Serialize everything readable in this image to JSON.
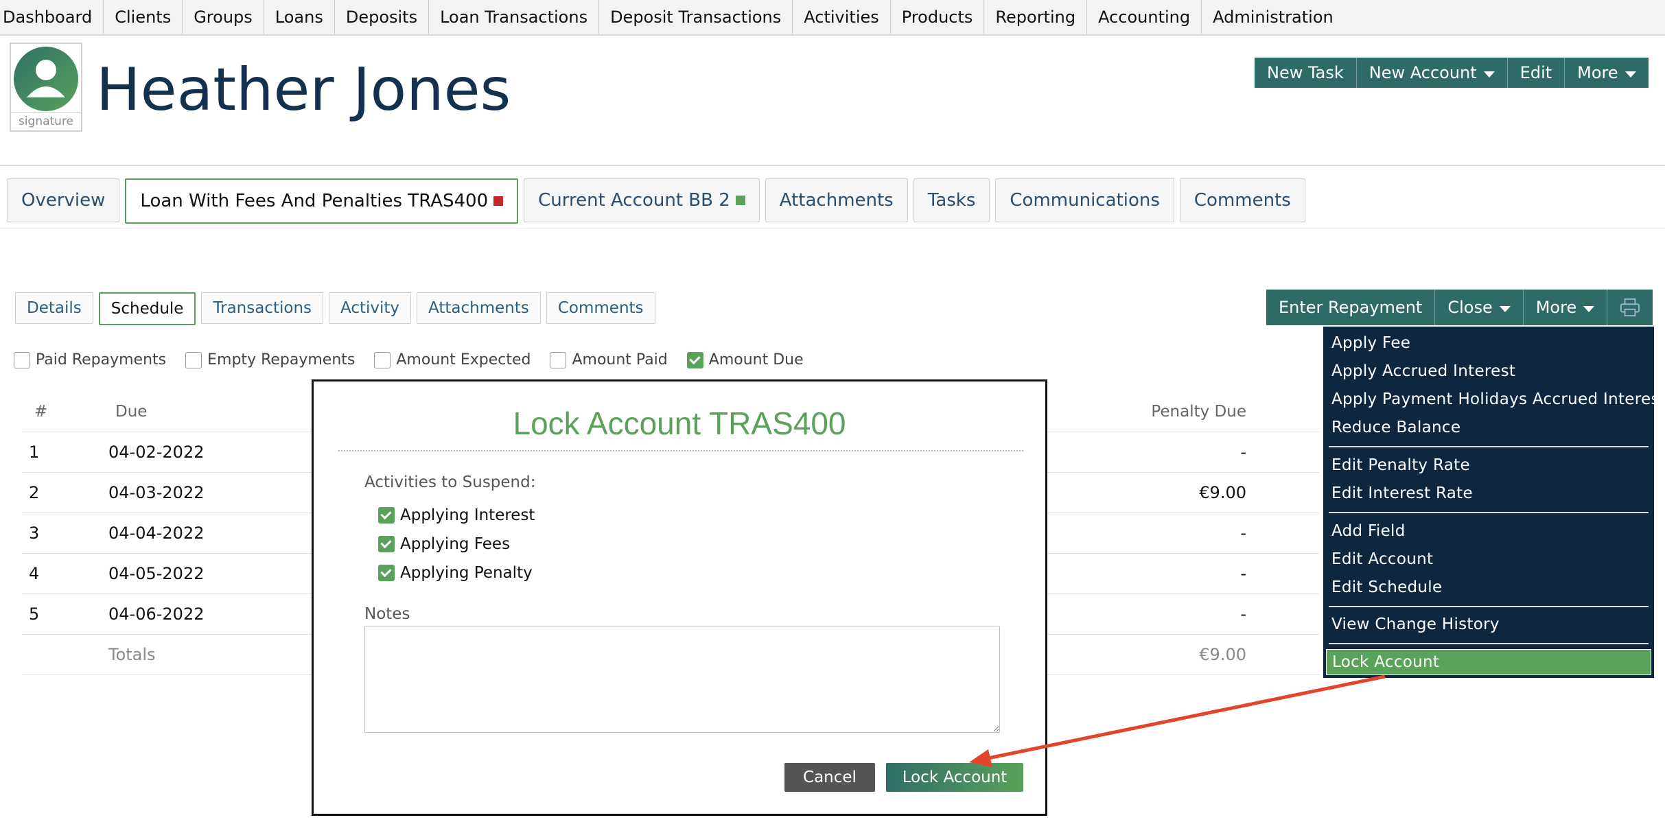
{
  "nav": [
    "Dashboard",
    "Clients",
    "Groups",
    "Loans",
    "Deposits",
    "Loan Transactions",
    "Deposit Transactions",
    "Activities",
    "Products",
    "Reporting",
    "Accounting",
    "Administration"
  ],
  "avatar": {
    "signature_label": "signature"
  },
  "client": {
    "name": "Heather Jones"
  },
  "header_actions": {
    "new_task": "New Task",
    "new_account": "New Account",
    "edit": "Edit",
    "more": "More"
  },
  "tabs": [
    {
      "label": "Overview"
    },
    {
      "label": "Loan With Fees And Penalties TRAS400",
      "marker_color": "#c62828"
    },
    {
      "label": "Current Account BB 2",
      "marker_color": "#5aa159"
    },
    {
      "label": "Attachments"
    },
    {
      "label": "Tasks"
    },
    {
      "label": "Communications"
    },
    {
      "label": "Comments"
    }
  ],
  "sub_tabs": [
    "Details",
    "Schedule",
    "Transactions",
    "Activity",
    "Attachments",
    "Comments"
  ],
  "loan_actions": {
    "enter_repayment": "Enter Repayment",
    "close": "Close",
    "more": "More",
    "print_icon": "printer-icon"
  },
  "filters": [
    {
      "label": "Paid Repayments",
      "checked": false
    },
    {
      "label": "Empty Repayments",
      "checked": false
    },
    {
      "label": "Amount Expected",
      "checked": false
    },
    {
      "label": "Amount Paid",
      "checked": false
    },
    {
      "label": "Amount Due",
      "checked": true
    }
  ],
  "schedule": {
    "headers": {
      "num": "#",
      "due": "Due",
      "penalty_due": "Penalty Due"
    },
    "rows": [
      {
        "num": "1",
        "due": "04-02-2022",
        "penalty": "-"
      },
      {
        "num": "2",
        "due": "04-03-2022",
        "penalty": "€9.00"
      },
      {
        "num": "3",
        "due": "04-04-2022",
        "penalty": "-"
      },
      {
        "num": "4",
        "due": "04-05-2022",
        "penalty": "-"
      },
      {
        "num": "5",
        "due": "04-06-2022",
        "penalty": "-"
      }
    ],
    "totals": {
      "label": "Totals",
      "penalty": "€9.00"
    }
  },
  "more_menu": [
    [
      "Apply Fee",
      "Apply Accrued Interest",
      "Apply Payment Holidays Accrued Interest",
      "Reduce Balance"
    ],
    [
      "Edit Penalty Rate",
      "Edit Interest Rate"
    ],
    [
      "Add Field",
      "Edit Account",
      "Edit Schedule"
    ],
    [
      "View Change History"
    ],
    [
      "Lock Account"
    ]
  ],
  "modal": {
    "title": "Lock Account TRAS400",
    "suspend_label": "Activities to Suspend:",
    "options": [
      {
        "label": "Applying Interest",
        "checked": true
      },
      {
        "label": "Applying Fees",
        "checked": true
      },
      {
        "label": "Applying Penalty",
        "checked": true
      }
    ],
    "notes_label": "Notes",
    "notes_value": "",
    "cancel": "Cancel",
    "submit": "Lock Account"
  },
  "colors": {
    "accent": "#5aa159",
    "teal": "#2e6b66",
    "navy_menu": "#0e2740",
    "annotation_arrow": "#e2452c"
  }
}
